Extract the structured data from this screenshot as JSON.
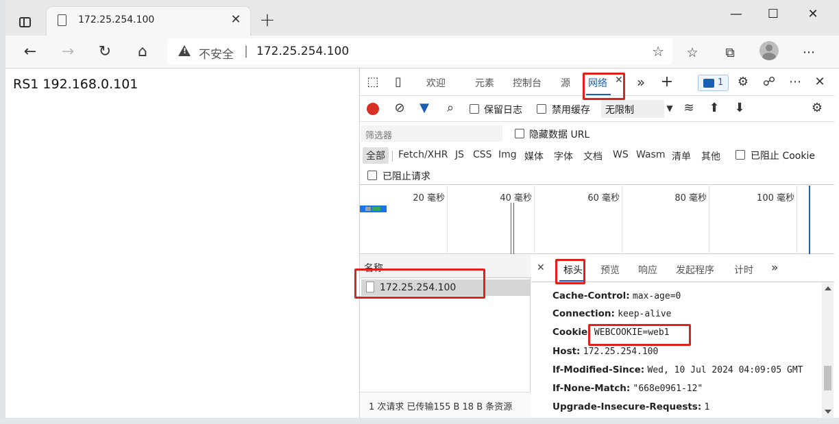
{
  "browser": {
    "tab_title": "172.25.254.100",
    "security_label": "不安全",
    "address_sep": "|",
    "url": "172.25.254.100",
    "new_tab_glyph": "+",
    "tab_close_glyph": "✕",
    "window_controls": {
      "minimize": "—",
      "maximize": "☐",
      "close": "✕"
    },
    "nav": {
      "back": "←",
      "forward": "→",
      "refresh": "↻",
      "home": "⌂"
    },
    "toolbar": {
      "favorites_add": "☆",
      "favorites": "☆",
      "collections": "⧉",
      "more": "···"
    }
  },
  "page": {
    "text": "RS1 192.168.0.101"
  },
  "devtools": {
    "tabs": {
      "welcome": "欢迎",
      "elements": "元素",
      "console": "控制台",
      "sources": "源",
      "network": "网络",
      "more": "»",
      "add": "+"
    },
    "issues_count": "1",
    "toolbar": {
      "preserve_log": "保留日志",
      "disable_cache": "禁用缓存",
      "throttle": "无限制"
    },
    "filter": {
      "placeholder": "筛选器",
      "hide_data_urls": "隐藏数据 URL"
    },
    "types": [
      "全部",
      "Fetch/XHR",
      "JS",
      "CSS",
      "Img",
      "媒体",
      "字体",
      "文档",
      "WS",
      "Wasm",
      "清单",
      "其他"
    ],
    "blocked_cookies": "已阻止 Cookie",
    "blocked_requests": "已阻止请求",
    "timeline": {
      "ticks": [
        "20 毫秒",
        "40 毫秒",
        "60 毫秒",
        "80 毫秒",
        "100 毫秒"
      ]
    },
    "request_list": {
      "header": "名称",
      "rows": [
        "172.25.254.100"
      ],
      "status": "1 次请求  已传输155 B  18 B 条资源"
    },
    "detail": {
      "tabs": [
        "标头",
        "预览",
        "响应",
        "发起程序",
        "计时"
      ],
      "more": "»",
      "headers": [
        {
          "k": "Cache-Control:",
          "v": "max-age=0"
        },
        {
          "k": "Connection:",
          "v": "keep-alive"
        },
        {
          "k": "Cookie:",
          "v": "WEBCOOKIE=web1"
        },
        {
          "k": "Host:",
          "v": "172.25.254.100"
        },
        {
          "k": "If-Modified-Since:",
          "v": "Wed, 10 Jul 2024 04:09:05 GMT"
        },
        {
          "k": "If-None-Match:",
          "v": "\"668e0961-12\""
        },
        {
          "k": "Upgrade-Insecure-Requests:",
          "v": "1"
        }
      ]
    }
  },
  "colors": {
    "highlight": "#e0201b",
    "accent": "#1a5fb4",
    "record": "#d93025"
  }
}
